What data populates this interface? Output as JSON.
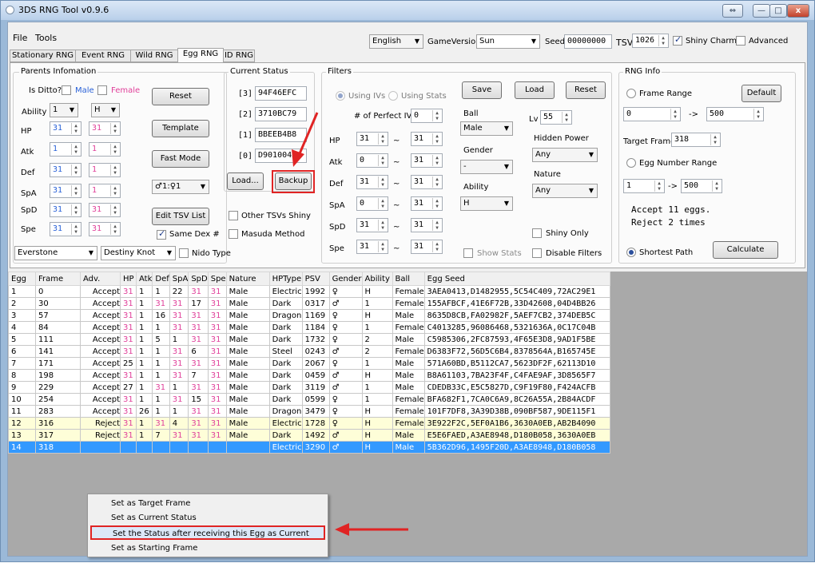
{
  "window": {
    "title": "3DS RNG Tool v0.9.6",
    "controls": [
      "⇔",
      "—",
      "□",
      "x"
    ]
  },
  "menu": [
    "File",
    "Tools"
  ],
  "top_bar": {
    "language": "English",
    "game_version_label": "GameVersion",
    "game_version": "Sun",
    "seed_label": "Seed",
    "seed": "00000000",
    "tsv_label": "TSV",
    "tsv": "1026",
    "shiny_charm_label": "Shiny Charm",
    "shiny_charm_checked": true,
    "advanced_label": "Advanced",
    "advanced_checked": false
  },
  "tabs": [
    {
      "label": "Stationary RNG",
      "active": false
    },
    {
      "label": "Event RNG",
      "active": false
    },
    {
      "label": "Wild RNG",
      "active": false
    },
    {
      "label": "Egg RNG",
      "active": true
    },
    {
      "label": "ID RNG",
      "active": false
    }
  ],
  "parents": {
    "title": "Parents Infomation",
    "is_ditto_label": "Is Ditto?",
    "male_label": "Male",
    "female_label": "Female",
    "ability_label": "Ability",
    "ability_male": "1",
    "ability_female": "H",
    "stats": [
      {
        "label": "HP",
        "male": "31",
        "female": "31"
      },
      {
        "label": "Atk",
        "male": "1",
        "female": "1"
      },
      {
        "label": "Def",
        "male": "31",
        "female": "1"
      },
      {
        "label": "SpA",
        "male": "31",
        "female": "1"
      },
      {
        "label": "SpD",
        "male": "31",
        "female": "31"
      },
      {
        "label": "Spe",
        "male": "31",
        "female": "31"
      }
    ],
    "reset_label": "Reset",
    "template_label": "Template",
    "fast_mode_label": "Fast Mode",
    "gender_ratio": "♂1:♀1",
    "edit_tsv_label": "Edit TSV List",
    "same_dex_label": "Same Dex #",
    "same_dex_checked": true,
    "male_item": "Everstone",
    "female_item": "Destiny Knot",
    "nido_label": "Nido Type"
  },
  "current_status": {
    "title": "Current Status",
    "rows": [
      {
        "idx": "[3]",
        "value": "94F46EFC"
      },
      {
        "idx": "[2]",
        "value": "3710BC79"
      },
      {
        "idx": "[1]",
        "value": "BBEEB4B8"
      },
      {
        "idx": "[0]",
        "value": "D9010043"
      }
    ],
    "load_label": "Load...",
    "backup_label": "Backup",
    "other_tsv_label": "Other TSVs Shiny",
    "masuda_label": "Masuda Method"
  },
  "filters": {
    "title": "Filters",
    "using_ivs_label": "Using IVs",
    "using_stats_label": "Using Stats",
    "perfect_ivs_label": "# of Perfect IVs",
    "perfect_ivs": "0",
    "tilde": "~",
    "iv_rows": [
      {
        "label": "HP",
        "min": "31",
        "max": "31"
      },
      {
        "label": "Atk",
        "min": "0",
        "max": "31"
      },
      {
        "label": "Def",
        "min": "31",
        "max": "31"
      },
      {
        "label": "SpA",
        "min": "0",
        "max": "31"
      },
      {
        "label": "SpD",
        "min": "31",
        "max": "31"
      },
      {
        "label": "Spe",
        "min": "31",
        "max": "31"
      }
    ],
    "save_label": "Save",
    "load_label": "Load",
    "reset_label": "Reset",
    "ball_label": "Ball",
    "ball": "Male",
    "lv_label": "Lv",
    "lv": "55",
    "gender_label": "Gender",
    "gender": "-",
    "hidden_power_label": "Hidden Power",
    "hidden_power": "Any",
    "nature_label": "Nature",
    "nature": "Any",
    "ability_label": "Ability",
    "ability": "H",
    "shiny_only_label": "Shiny Only",
    "show_stats_label": "Show Stats",
    "disable_filters_label": "Disable Filters"
  },
  "rng_info": {
    "title": "RNG Info",
    "frame_range_label": "Frame Range",
    "default_label": "Default",
    "frame_from": "0",
    "arrow": "->",
    "frame_to": "500",
    "target_frame_label": "Target Frame",
    "target_frame": "318",
    "egg_number_label": "Egg Number Range",
    "egg_from": "1",
    "egg_to": "500",
    "result_line1": "Accept 11 eggs.",
    "result_line2": "Reject 2 times",
    "shortest_path_label": "Shortest Path",
    "calculate_label": "Calculate"
  },
  "table": {
    "columns": [
      "Egg",
      "Frame",
      "Adv.",
      "HP",
      "Atk",
      "Def",
      "SpA",
      "SpD",
      "Spe",
      "Nature",
      "HPType",
      "PSV",
      "Gender",
      "Ability",
      "Ball",
      "Egg Seed"
    ],
    "rows": [
      [
        "1",
        "0",
        "Accept",
        "31",
        "1",
        "1",
        "22",
        "31",
        "31",
        "Male",
        "Electric",
        "1992",
        "♀",
        "H",
        "Female",
        "3AEA0413,D1482955,5C54C409,72AC29E1"
      ],
      [
        "2",
        "30",
        "Accept",
        "31",
        "1",
        "31",
        "31",
        "17",
        "31",
        "Male",
        "Dark",
        "0317",
        "♂",
        "1",
        "Female",
        "155AFBCF,41E6F72B,33D42608,04D4BB26"
      ],
      [
        "3",
        "57",
        "Accept",
        "31",
        "1",
        "16",
        "31",
        "31",
        "31",
        "Male",
        "Dragon",
        "1169",
        "♀",
        "H",
        "Male",
        "8635D8CB,FA02982F,5AEF7CB2,374DEB5C"
      ],
      [
        "4",
        "84",
        "Accept",
        "31",
        "1",
        "1",
        "31",
        "31",
        "31",
        "Male",
        "Dark",
        "1184",
        "♀",
        "1",
        "Female",
        "C4013285,96086468,5321636A,0C17C04B"
      ],
      [
        "5",
        "111",
        "Accept",
        "31",
        "1",
        "5",
        "1",
        "31",
        "31",
        "Male",
        "Dark",
        "1732",
        "♀",
        "2",
        "Male",
        "C5985306,2FC87593,4F65E3D8,9AD1F5BE"
      ],
      [
        "6",
        "141",
        "Accept",
        "31",
        "1",
        "1",
        "31",
        "6",
        "31",
        "Male",
        "Steel",
        "0243",
        "♂",
        "2",
        "Female",
        "D6383F72,56D5C6B4,8378564A,B165745E"
      ],
      [
        "7",
        "171",
        "Accept",
        "25",
        "1",
        "1",
        "31",
        "31",
        "31",
        "Male",
        "Dark",
        "2067",
        "♀",
        "1",
        "Male",
        "571A60BD,B5112CA7,5623DF2F,62113D10"
      ],
      [
        "8",
        "198",
        "Accept",
        "31",
        "1",
        "1",
        "31",
        "7",
        "31",
        "Male",
        "Dark",
        "0459",
        "♂",
        "H",
        "Male",
        "B8A61103,7BA23F4F,C4FAE9AF,3D8565F7"
      ],
      [
        "9",
        "229",
        "Accept",
        "27",
        "1",
        "31",
        "1",
        "31",
        "31",
        "Male",
        "Dark",
        "3119",
        "♂",
        "1",
        "Male",
        "CDEDB33C,E5C5827D,C9F19F80,F424ACFB"
      ],
      [
        "10",
        "254",
        "Accept",
        "31",
        "1",
        "1",
        "31",
        "15",
        "31",
        "Male",
        "Dark",
        "0599",
        "♀",
        "1",
        "Female",
        "BFA682F1,7CA0C6A9,8C26A55A,2B84ACDF"
      ],
      [
        "11",
        "283",
        "Accept",
        "31",
        "26",
        "1",
        "1",
        "31",
        "31",
        "Male",
        "Dragon",
        "3479",
        "♀",
        "H",
        "Female",
        "101F7DF8,3A39D38B,090BF587,9DE115F1"
      ],
      [
        "12",
        "316",
        "Reject",
        "31",
        "1",
        "31",
        "4",
        "31",
        "31",
        "Male",
        "Electric",
        "1728",
        "♀",
        "H",
        "Female",
        "3E922F2C,5EF0A1B6,3630A0EB,AB2B4090"
      ],
      [
        "13",
        "317",
        "Reject",
        "31",
        "1",
        "7",
        "31",
        "31",
        "31",
        "Male",
        "Dark",
        "1492",
        "♂",
        "H",
        "Male",
        "E5E6FAED,A3AE8948,D180B058,3630A0EB"
      ],
      [
        "14",
        "318",
        "",
        "",
        "",
        "",
        "",
        "",
        "",
        "",
        "Electric",
        "3290",
        "♂",
        "H",
        "Male",
        "5B362D96,1495F20D,A3AE8948,D180B058"
      ]
    ]
  },
  "context_menu": {
    "items": [
      "Set as Target Frame",
      "Set as Current Status",
      "Set the Status after receiving this Egg as Current",
      "Set as Starting Frame"
    ]
  }
}
